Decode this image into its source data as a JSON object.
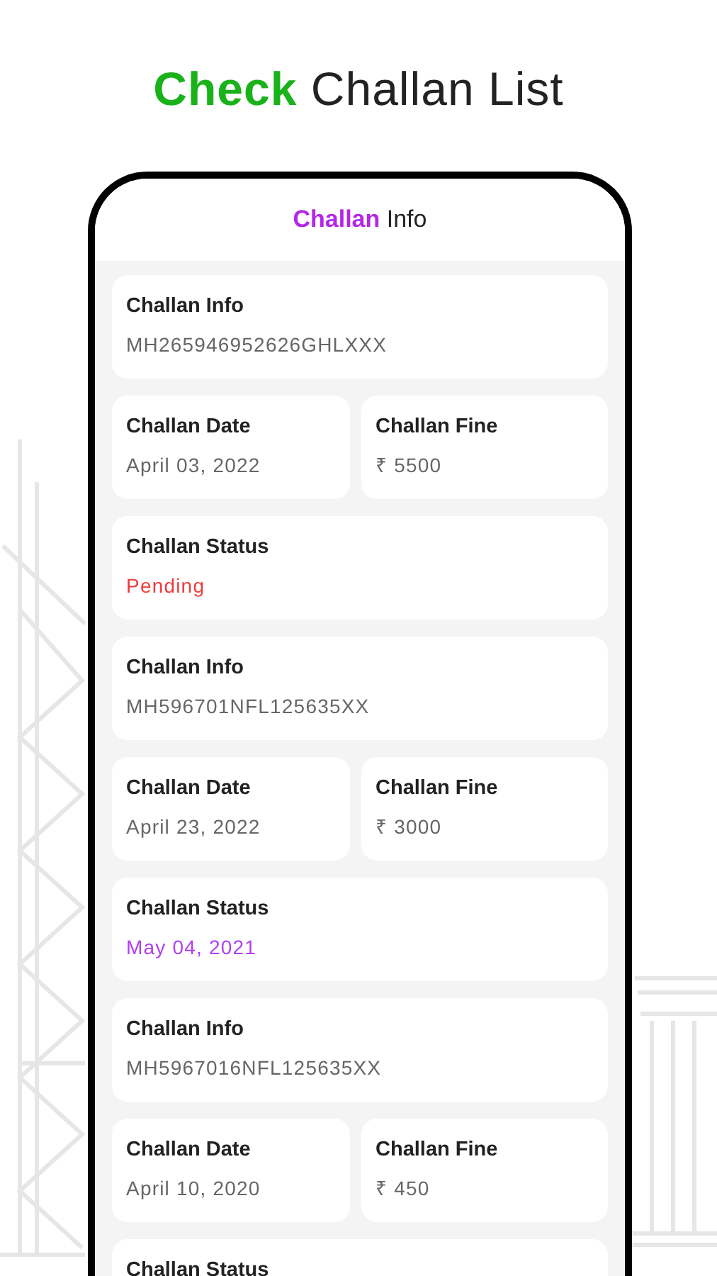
{
  "headline": "**Check** Challan List",
  "screen": {
    "title": "**Challan** Info",
    "records": [
      {
        "info_label": "Challan Info",
        "info": "MH265946952626GHLXXX",
        "date_label": "Challan Date",
        "date": "April 03, 2022",
        "fine_label": "Challan Fine",
        "fine": "₹ 5500",
        "status_label": "Challan Status",
        "status": "Pending",
        "color": "#f03a3a"
      },
      {
        "info_label": "Challan Info",
        "info": "MH596701NFL125635XX",
        "date_label": "Challan Date",
        "date": "April 23, 2022",
        "fine_label": "Challan Fine",
        "fine": "₹ 3000",
        "status_label": "Challan Status",
        "status": "May 04, 2021",
        "color": "#b040f0"
      },
      {
        "info_label": "Challan Info",
        "info": "MH5967016NFL125635XX",
        "date_label": "Challan Date",
        "date": "April 10, 2020",
        "fine_label": "Challan Fine",
        "fine": "₹ 450",
        "status_label": "Challan Status"
      }
    ]
  }
}
